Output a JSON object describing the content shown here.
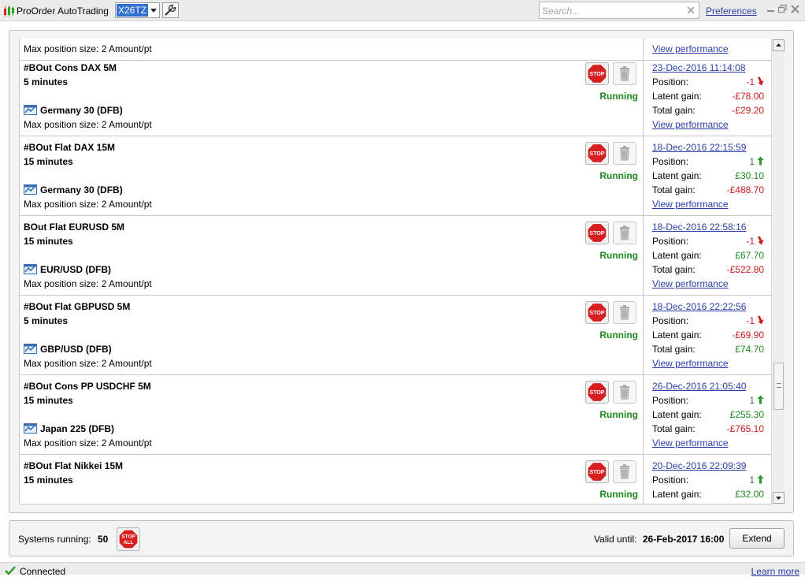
{
  "app": {
    "title": "ProOrder AutoTrading",
    "account": "X26TZ"
  },
  "search": {
    "placeholder": "Search...",
    "value": ""
  },
  "header": {
    "preferences_label": "Preferences"
  },
  "labels": {
    "position": "Position:",
    "latent_gain": "Latent gain:",
    "total_gain": "Total gain:",
    "view_performance": "View performance",
    "running": "Running"
  },
  "partial_top": {
    "max_position": "Max position size: 2 Amount/pt",
    "link": "View performance"
  },
  "systems": [
    {
      "name": "#BOut Cons DAX 5M",
      "timeframe": "5 minutes",
      "instrument": "Germany 30 (DFB)",
      "max_position": "Max position size: 2 Amount/pt",
      "status": "Running",
      "date": "23-Dec-2016 11:14:08",
      "position": "-1",
      "direction": "down",
      "latent_gain": "-£78.00",
      "latent_sign": "neg",
      "total_gain": "-£29.20",
      "total_sign": "neg"
    },
    {
      "name": "#BOut Flat DAX 15M",
      "timeframe": "15 minutes",
      "instrument": "Germany 30 (DFB)",
      "max_position": "Max position size: 2 Amount/pt",
      "status": "Running",
      "date": "18-Dec-2016 22:15:59",
      "position": "1",
      "direction": "up",
      "latent_gain": "£30.10",
      "latent_sign": "pos",
      "total_gain": "-£488.70",
      "total_sign": "neg"
    },
    {
      "name": "BOut Flat EURUSD 5M",
      "timeframe": "15 minutes",
      "instrument": "EUR/USD (DFB)",
      "max_position": "Max position size: 2 Amount/pt",
      "status": "Running",
      "date": "18-Dec-2016 22:58:16",
      "position": "-1",
      "direction": "down",
      "latent_gain": "£67.70",
      "latent_sign": "pos",
      "total_gain": "-£522.80",
      "total_sign": "neg"
    },
    {
      "name": "#BOut Flat GBPUSD 5M",
      "timeframe": "5 minutes",
      "instrument": "GBP/USD (DFB)",
      "max_position": "Max position size: 2 Amount/pt",
      "status": "Running",
      "date": "18-Dec-2016 22:22:56",
      "position": "-1",
      "direction": "down",
      "latent_gain": "-£69.90",
      "latent_sign": "neg",
      "total_gain": "£74.70",
      "total_sign": "pos"
    },
    {
      "name": "#BOut Cons PP USDCHF 5M",
      "timeframe": "15 minutes",
      "instrument": "Japan 225 (DFB)",
      "max_position": "Max position size: 2 Amount/pt",
      "status": "Running",
      "date": "26-Dec-2016 21:05:40",
      "position": "1",
      "direction": "up",
      "latent_gain": "£255.30",
      "latent_sign": "pos",
      "total_gain": "-£765.10",
      "total_sign": "neg"
    },
    {
      "name": "#BOut Flat Nikkei 15M",
      "timeframe": "15 minutes",
      "instrument": "",
      "max_position": "",
      "status": "Running",
      "date": "20-Dec-2016 22:09:39",
      "position": "1",
      "direction": "up",
      "latent_gain": "£32.00",
      "latent_sign": "pos",
      "total_gain": "",
      "total_sign": ""
    }
  ],
  "footer": {
    "systems_running_label": "Systems running:",
    "systems_running_count": "50",
    "stop_all_label": "STOP ALL",
    "valid_until_label": "Valid until:",
    "valid_until_value": "26-Feb-2017 16:00",
    "extend_label": "Extend"
  },
  "status_bar": {
    "connection": "Connected",
    "learn_more": "Learn more"
  },
  "colors": {
    "link": "#2a3fa8",
    "positive": "#1e8a1e",
    "negative": "#c81c1c",
    "stop_red": "#d71f1f"
  },
  "scrollbar": {
    "position_fraction": 0.71
  }
}
